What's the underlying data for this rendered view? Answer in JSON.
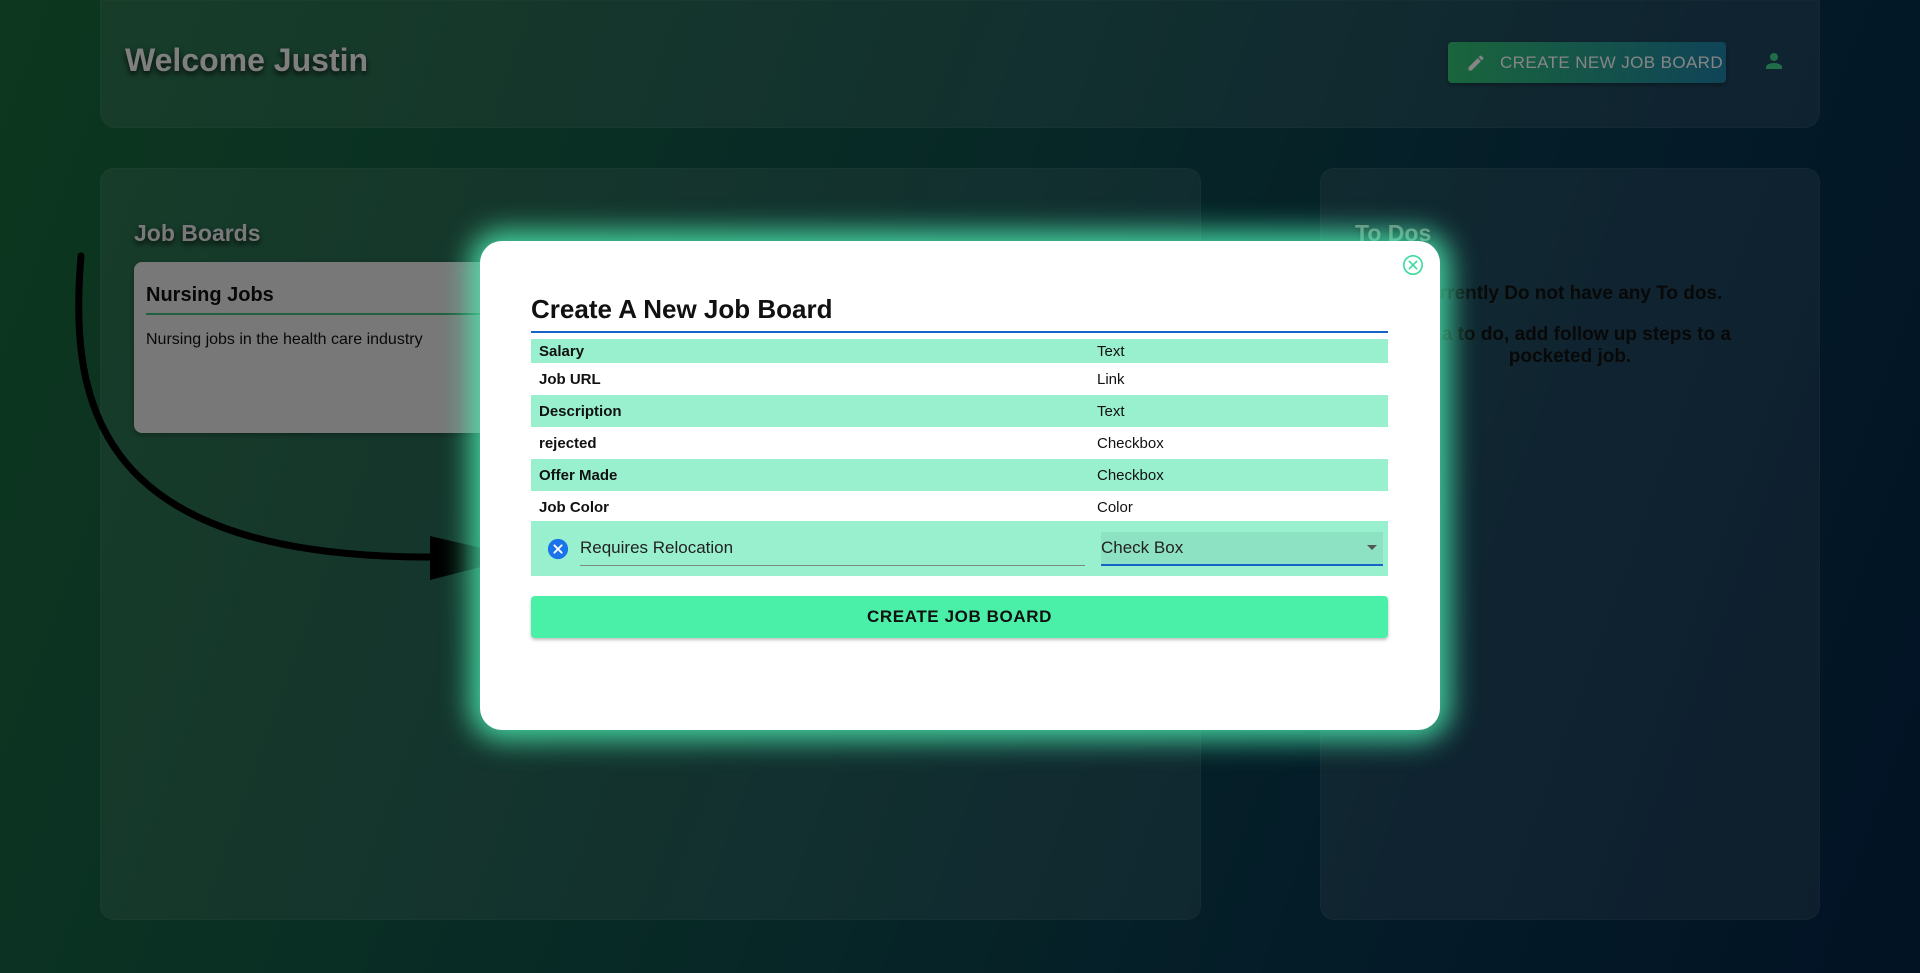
{
  "header": {
    "welcome": "Welcome Justin",
    "create_button_label": "CREATE NEW JOB BOARD"
  },
  "job_boards": {
    "title": "Job Boards",
    "cards": [
      {
        "title": "Nursing Jobs",
        "description": "Nursing jobs in the health care industry"
      }
    ]
  },
  "todos": {
    "title": "To Dos",
    "empty_line1": "currently Do not have any To dos.",
    "empty_line2": "ate a to do, add follow up steps to a pocketed job."
  },
  "modal": {
    "title": "Create A New Job Board",
    "fields": [
      {
        "name": "Salary",
        "type": "Text"
      },
      {
        "name": "Job URL",
        "type": "Link"
      },
      {
        "name": "Description",
        "type": "Text"
      },
      {
        "name": "rejected",
        "type": "Checkbox"
      },
      {
        "name": "Offer Made",
        "type": "Checkbox"
      },
      {
        "name": "Job Color",
        "type": "Color"
      }
    ],
    "new_field": {
      "name_value": "Requires Relocation",
      "type_value": "Check Box"
    },
    "submit_label": "CREATE JOB BOARD"
  },
  "colors": {
    "modal_glow": "#4ef0b4",
    "row_highlight": "#98f0cf",
    "submit_bg": "#4af0a7",
    "accent_blue": "#1763c7"
  },
  "icons": {
    "pencil": "pencil-icon",
    "user": "user-icon",
    "close": "close-circle-icon",
    "remove": "remove-circle-icon",
    "dropdown": "chevron-down-icon"
  }
}
